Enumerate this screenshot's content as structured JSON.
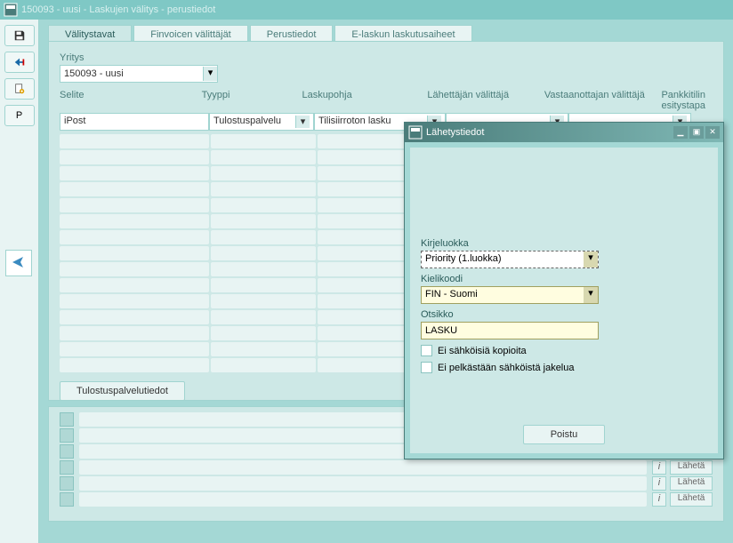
{
  "window": {
    "title": "150093 - uusi - Laskujen välitys - perustiedot"
  },
  "tabs": [
    {
      "label": "Välitystavat",
      "active": true
    },
    {
      "label": "Finvoicen välittäjät",
      "active": false
    },
    {
      "label": "Perustiedot",
      "active": false
    },
    {
      "label": "E-laskun laskutusaiheet",
      "active": false
    }
  ],
  "toolbar": {
    "save": "save-icon",
    "back": "back-icon",
    "new": "new-icon",
    "p": "P"
  },
  "company": {
    "label": "Yritys",
    "value": "150093 - uusi"
  },
  "grid": {
    "headers": {
      "selite": "Selite",
      "tyyppi": "Tyyppi",
      "laskupohja": "Laskupohja",
      "lahettaja": "Lähettäjän välittäjä",
      "vastaanottaja": "Vastaanottajan välittäjä",
      "pankki": "Pankkitilin esitystapa"
    },
    "row": {
      "selite": "iPost",
      "tyyppi": "Tulostuspalvelu",
      "laskupohja": "Tilisiirroton lasku",
      "lahettaja": "",
      "vastaanottaja": ""
    }
  },
  "button": {
    "tulostus": "Tulostuspalvelutiedot"
  },
  "lower": {
    "i": "i",
    "send": "Lähetä"
  },
  "dialog": {
    "title": "Lähetystiedot",
    "kirjeluokka": {
      "label": "Kirjeluokka",
      "value": "Priority (1.luokka)"
    },
    "kielikoodi": {
      "label": "Kielikoodi",
      "value": "FIN - Suomi"
    },
    "otsikko": {
      "label": "Otsikko",
      "value": "LASKU"
    },
    "chk1": "Ei sähköisiä kopioita",
    "chk2": "Ei pelkästään sähköistä jakelua",
    "close": "Poistu"
  }
}
